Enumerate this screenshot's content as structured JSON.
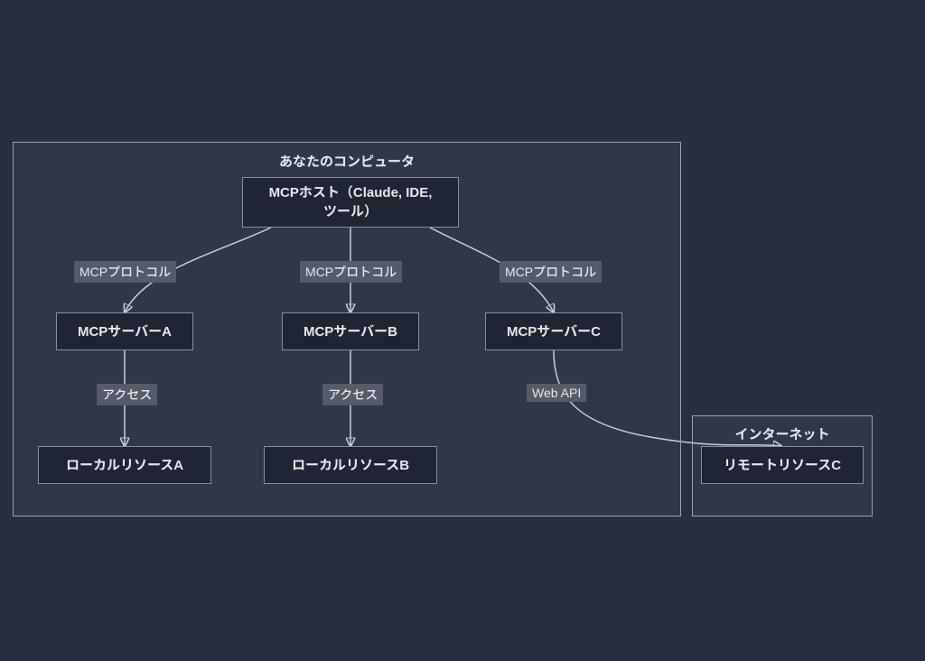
{
  "containers": {
    "computer": {
      "title": "あなたのコンピュータ"
    },
    "internet": {
      "title": "インターネット"
    }
  },
  "nodes": {
    "host": {
      "line1": "MCPホスト（Claude, IDE,",
      "line2": "ツール）"
    },
    "serverA": {
      "label": "MCPサーバーA"
    },
    "serverB": {
      "label": "MCPサーバーB"
    },
    "serverC": {
      "label": "MCPサーバーC"
    },
    "resourceA": {
      "label": "ローカルリソースA"
    },
    "resourceB": {
      "label": "ローカルリソースB"
    },
    "resourceC": {
      "label": "リモートリソースC"
    }
  },
  "edges": {
    "host_a": "MCPプロトコル",
    "host_b": "MCPプロトコル",
    "host_c": "MCPプロトコル",
    "a_resA": "アクセス",
    "b_resB": "アクセス",
    "c_resC": "Web API"
  }
}
